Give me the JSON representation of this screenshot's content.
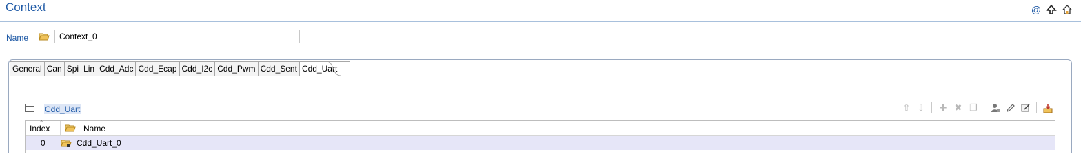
{
  "header": {
    "title": "Context"
  },
  "name_field": {
    "label": "Name",
    "value": "Context_0"
  },
  "tabs": [
    {
      "label": "General"
    },
    {
      "label": "Can"
    },
    {
      "label": "Spi"
    },
    {
      "label": "Lin"
    },
    {
      "label": "Cdd_Adc"
    },
    {
      "label": "Cdd_Ecap"
    },
    {
      "label": "Cdd_I2c"
    },
    {
      "label": "Cdd_Pwm"
    },
    {
      "label": "Cdd_Sent"
    },
    {
      "label": "Cdd_Uart"
    }
  ],
  "active_tab": "Cdd_Uart",
  "section": {
    "title": "Cdd_Uart"
  },
  "table": {
    "columns": [
      "Index",
      "Name"
    ],
    "rows": [
      {
        "index": "0",
        "name": "Cdd_Uart_0"
      }
    ]
  },
  "colors": {
    "accent": "#1f5aa6",
    "selected_row": "#e6e6f8"
  }
}
